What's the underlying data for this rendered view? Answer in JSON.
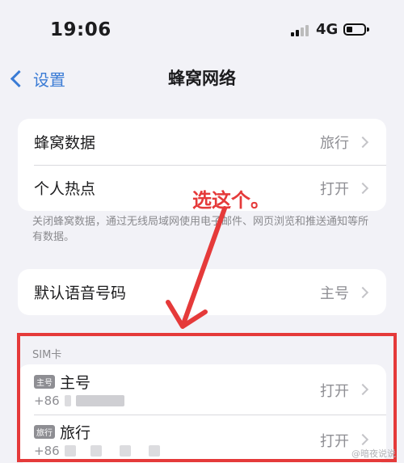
{
  "status_bar": {
    "time": "19:06",
    "network": "4G"
  },
  "nav": {
    "back_label": "设置",
    "title": "蜂窝网络"
  },
  "group1": {
    "rows": [
      {
        "label": "蜂窝数据",
        "value": "旅行"
      },
      {
        "label": "个人热点",
        "value": "打开"
      }
    ],
    "footnote": "关闭蜂窝数据，通过无线局域网使用电子邮件、网页浏览和推送通知等所有数据。"
  },
  "group2": {
    "rows": [
      {
        "label": "默认语音号码",
        "value": "主号"
      }
    ]
  },
  "sim_section": {
    "header": "SIM卡",
    "lines": [
      {
        "badge": "主号",
        "name": "主号",
        "number": "+86",
        "status": "打开"
      },
      {
        "badge": "旅行",
        "name": "旅行",
        "number": "+86",
        "status": "打开"
      }
    ]
  },
  "annotation": {
    "text": "选这个。",
    "color": "#e53a3a"
  },
  "watermark": "@暗夜说说",
  "colors": {
    "accent": "#3a7bd5",
    "background": "#f2f2f7",
    "annotation": "#e53a3a"
  },
  "icons": [
    "signal-icon",
    "battery-icon",
    "back-chevron-icon",
    "chevron-right-icon",
    "arrow-icon"
  ]
}
